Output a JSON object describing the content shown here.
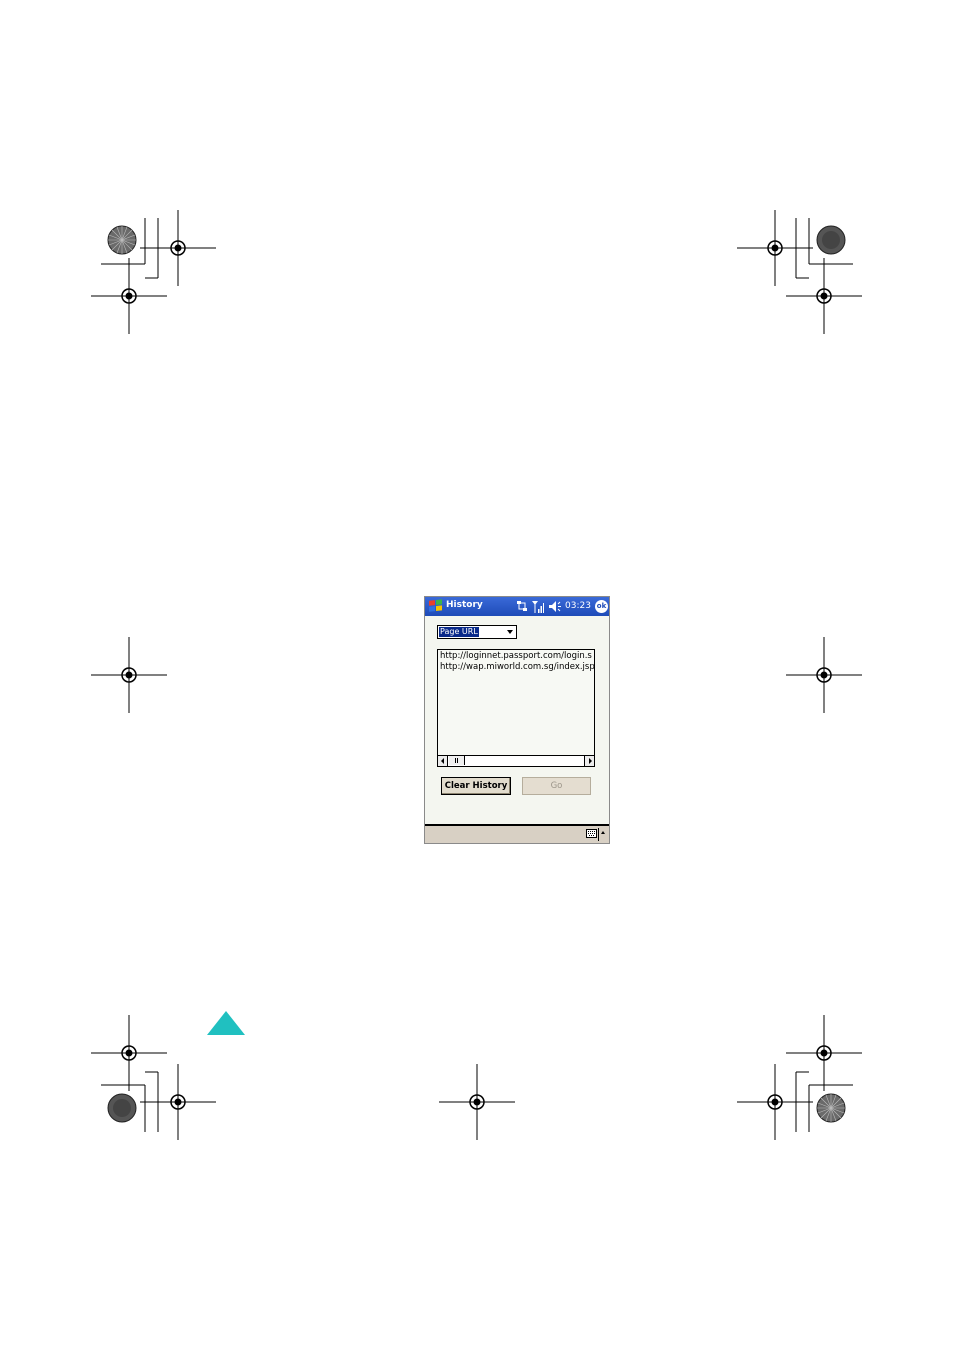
{
  "titlebar": {
    "title": "History",
    "clock": "03:23",
    "ok_label": "ok",
    "icons": [
      "windows-start-icon",
      "connectivity-icon",
      "signal-icon",
      "speaker-icon"
    ]
  },
  "history": {
    "dropdown_value": "Page URL",
    "entries": [
      "http://loginnet.passport.com/login.s",
      "http://wap.miworld.com.sg/index.jsp"
    ]
  },
  "buttons": {
    "clear_history": "Clear History",
    "go": "Go"
  },
  "colors": {
    "titlebar": "#1e4bb8",
    "page_marker": "#20c0c0",
    "bottom_bar": "#d8d0c4"
  }
}
